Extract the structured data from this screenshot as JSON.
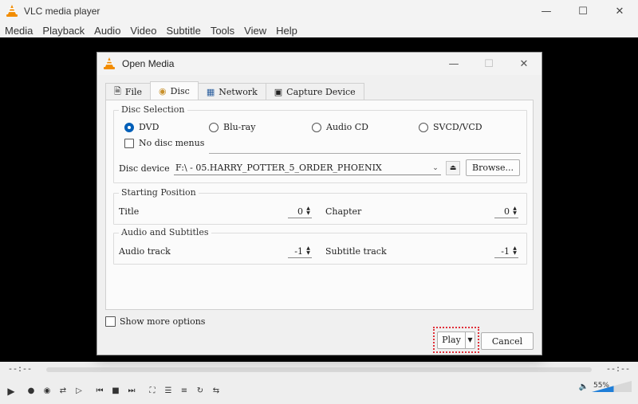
{
  "app": {
    "title": "VLC media player",
    "menu": [
      "Media",
      "Playback",
      "Audio",
      "Video",
      "Subtitle",
      "Tools",
      "View",
      "Help"
    ],
    "time_elapsed": "--:--",
    "time_total": "--:--",
    "volume_label": "55%",
    "volume_level": 55,
    "accent": "#005fb8",
    "icons": {
      "minimize": "minimize-icon",
      "maximize": "maximize-icon",
      "close": "close-icon"
    }
  },
  "dialog": {
    "title": "Open Media",
    "tabs": [
      {
        "label": "File",
        "icon": "file-icon"
      },
      {
        "label": "Disc",
        "icon": "disc-icon"
      },
      {
        "label": "Network",
        "icon": "network-icon"
      },
      {
        "label": "Capture Device",
        "icon": "capture-device-icon"
      }
    ],
    "active_tab": "Disc",
    "disc_selection": {
      "label": "Disc Selection",
      "options": [
        "DVD",
        "Blu-ray",
        "Audio CD",
        "SVCD/VCD"
      ],
      "selected": "DVD",
      "no_disc_menus": "No disc menus",
      "device_label": "Disc device",
      "device_value": "F:\\ - 05.HARRY_POTTER_5_ORDER_PHOENIX",
      "browse": "Browse..."
    },
    "starting_position": {
      "label": "Starting Position",
      "title_label": "Title",
      "title_value": "0",
      "chapter_label": "Chapter",
      "chapter_value": "0"
    },
    "audio_subtitles": {
      "label": "Audio and Subtitles",
      "audio_label": "Audio track",
      "audio_value": "-1",
      "subtitle_label": "Subtitle track",
      "subtitle_value": "-1"
    },
    "show_more": "Show more options",
    "play": "Play",
    "cancel": "Cancel",
    "highlight_color": "#e0303a"
  }
}
